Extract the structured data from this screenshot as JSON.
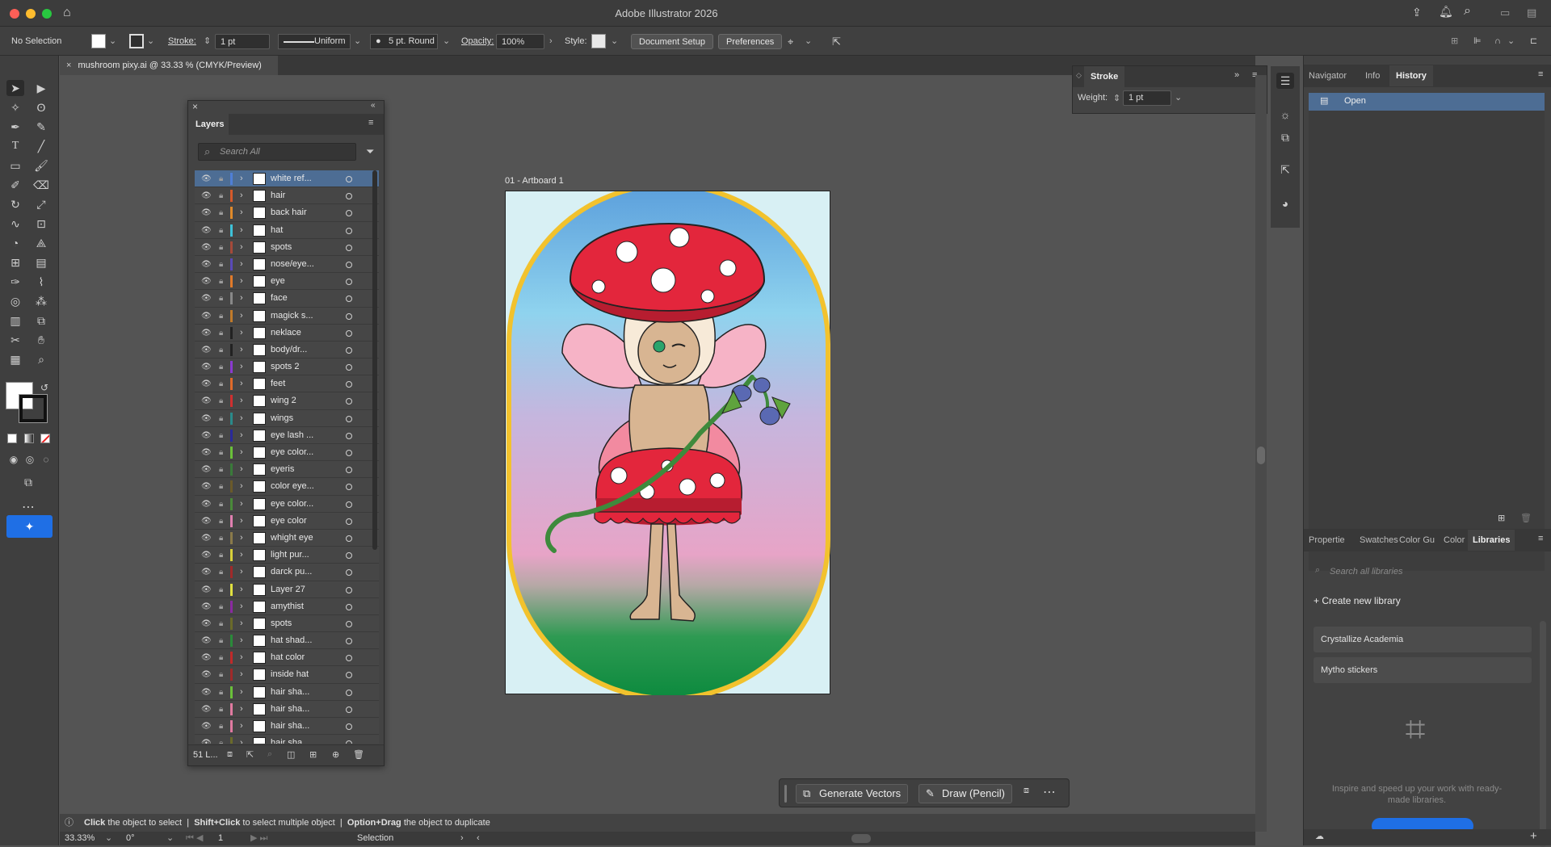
{
  "window": {
    "title": "Adobe Illustrator 2026"
  },
  "control_bar": {
    "selection": "No Selection",
    "stroke_label": "Stroke:",
    "stroke_value": "1 pt",
    "profile": "Uniform",
    "brush": "5 pt. Round",
    "opacity_label": "Opacity:",
    "opacity_value": "100%",
    "style_label": "Style:",
    "document_setup": "Document Setup",
    "preferences": "Preferences"
  },
  "document_tab": "mushroom pixy.ai @ 33.33 % (CMYK/Preview)",
  "layers_panel": {
    "title": "Layers",
    "search_placeholder": "Search All",
    "count": "51 L...",
    "layers": [
      {
        "name": "white ref...",
        "color": "#4f7fd6",
        "selected": true
      },
      {
        "name": "hair",
        "color": "#d55a2a"
      },
      {
        "name": "back hair",
        "color": "#e08a2a"
      },
      {
        "name": "hat",
        "color": "#3ec1d8"
      },
      {
        "name": "spots",
        "color": "#a54a3a"
      },
      {
        "name": "nose/eye...",
        "color": "#5a4ab8"
      },
      {
        "name": "eye",
        "color": "#e07a2a"
      },
      {
        "name": "face",
        "color": "#888888"
      },
      {
        "name": "magick s...",
        "color": "#c07a2a"
      },
      {
        "name": "neklace",
        "color": "#222222"
      },
      {
        "name": "body/dr...",
        "color": "#222222"
      },
      {
        "name": "spots 2",
        "color": "#8a3ad0"
      },
      {
        "name": "feet",
        "color": "#e06a2a"
      },
      {
        "name": "wing 2",
        "color": "#d03030"
      },
      {
        "name": "wings",
        "color": "#2a8a8a"
      },
      {
        "name": "eye lash ...",
        "color": "#2a2a9a"
      },
      {
        "name": "eye color...",
        "color": "#6ac03a"
      },
      {
        "name": "eyeris",
        "color": "#3a7a3a"
      },
      {
        "name": "color eye...",
        "color": "#6a5a2a"
      },
      {
        "name": "eye color...",
        "color": "#4a8a3a"
      },
      {
        "name": "eye color",
        "color": "#e080b0"
      },
      {
        "name": "whight eye",
        "color": "#8a7a4a"
      },
      {
        "name": "light pur...",
        "color": "#d8d03a"
      },
      {
        "name": "darck pu...",
        "color": "#a02a2a"
      },
      {
        "name": "Layer 27",
        "color": "#e0e040"
      },
      {
        "name": "amythist",
        "color": "#8a2aa0"
      },
      {
        "name": "spots",
        "color": "#6a6a2a"
      },
      {
        "name": "hat shad...",
        "color": "#2a8a3a"
      },
      {
        "name": "hat color",
        "color": "#c02a2a"
      },
      {
        "name": "inside hat",
        "color": "#a02a2a"
      },
      {
        "name": "hair sha...",
        "color": "#6ac03a"
      },
      {
        "name": "hair sha...",
        "color": "#e07aa0"
      },
      {
        "name": "hair sha...",
        "color": "#e07aa0"
      },
      {
        "name": "hair sha...",
        "color": "#6a6a2a"
      }
    ]
  },
  "artboard": {
    "label": "01 - Artboard 1"
  },
  "stroke_panel": {
    "title": "Stroke",
    "weight_label": "Weight:",
    "weight_value": "1 pt"
  },
  "right_panel": {
    "tabs_top": [
      "Navigator",
      "Info",
      "History"
    ],
    "history_items": [
      "Open"
    ],
    "tabs_bottom": [
      "Propertie",
      "Swatches",
      "Color Gu",
      "Color",
      "Libraries"
    ],
    "libraries_search": "Search all libraries",
    "create_library": "Create new library",
    "libraries": [
      "Crystallize Academia",
      "Mytho stickers"
    ],
    "empty_text": "Inspire and speed up your work with ready-made libraries."
  },
  "generate_bar": {
    "generate_vectors": "Generate Vectors",
    "draw_pencil": "Draw (Pencil)"
  },
  "status": {
    "click": "Click",
    "click_text": "the object to select",
    "shift": "Shift+Click",
    "shift_text": "to select multiple object",
    "option": "Option+Drag",
    "option_text": "the object to duplicate"
  },
  "bottom_bar": {
    "zoom": "33.33%",
    "angle": "0°",
    "artboard_num": "1",
    "tool": "Selection"
  }
}
